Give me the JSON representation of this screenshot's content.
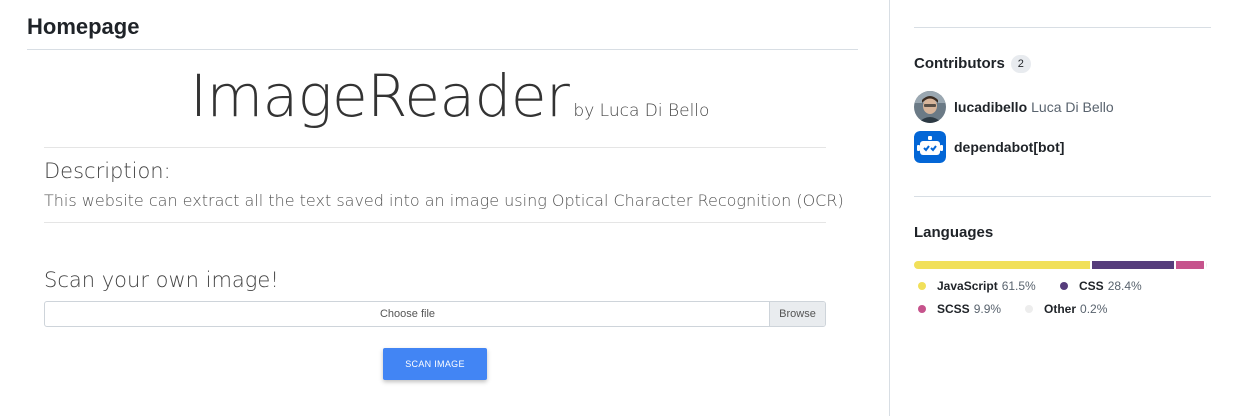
{
  "readme": {
    "title": "Homepage",
    "logo_main": "ImageReader",
    "logo_by": "by Luca Di Bello",
    "description_heading": "Description:",
    "description_text": "This website can extract all the text saved into an image using Optical Character Recognition (OCR)",
    "scan_heading": "Scan your own image!",
    "file_input": {
      "placeholder": "Choose file",
      "browse_label": "Browse"
    },
    "scan_button_label": "SCAN IMAGE",
    "scan_button_color": "#4285f4"
  },
  "sidebar": {
    "contributors": {
      "heading": "Contributors",
      "count": "2",
      "people": [
        {
          "login": "lucadibello",
          "name": "Luca Di Bello",
          "avatar_icon": "user-photo-avatar"
        },
        {
          "login": "dependabot[bot]",
          "name": "",
          "avatar_icon": "dependabot-icon"
        }
      ]
    },
    "languages": {
      "heading": "Languages",
      "items": [
        {
          "name": "JavaScript",
          "percent": "61.5%",
          "value": 61.5,
          "color": "#f1e05a"
        },
        {
          "name": "CSS",
          "percent": "28.4%",
          "value": 28.4,
          "color": "#563d7c"
        },
        {
          "name": "SCSS",
          "percent": "9.9%",
          "value": 9.9,
          "color": "#c6538c"
        },
        {
          "name": "Other",
          "percent": "0.2%",
          "value": 0.2,
          "color": "#ededed"
        }
      ]
    }
  }
}
